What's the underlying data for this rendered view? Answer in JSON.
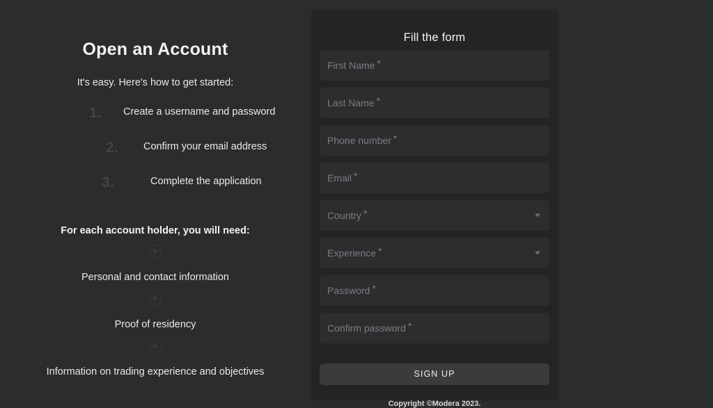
{
  "page": {
    "background_color": "#2b2c2e"
  },
  "left": {
    "title": "Open an Account",
    "intro": "It's easy. Here's how to get started:",
    "steps": [
      {
        "number": "1.",
        "text": "Create a username and password"
      },
      {
        "number": "2.",
        "text": "Confirm your email address"
      },
      {
        "number": "3.",
        "text": "Complete the application"
      }
    ],
    "needs_heading": "For each account holder, you will need:",
    "needs": [
      {
        "icon": "plus-circle-icon",
        "text": "Personal and contact information"
      },
      {
        "icon": "plus-circle-icon",
        "text": "Proof of residency"
      },
      {
        "icon": "plus-circle-icon",
        "text": "Information on trading experience and objectives"
      }
    ]
  },
  "form": {
    "title": "Fill the form",
    "background_color": "#232426",
    "field_background_color": "#2c2d2f",
    "required_marker": "*",
    "fields": [
      {
        "label": "First Name",
        "value": "",
        "placeholder": "First Name",
        "type": "text",
        "required": true
      },
      {
        "label": "Last Name",
        "value": "",
        "placeholder": "Last Name",
        "type": "text",
        "required": true
      },
      {
        "label": "Phone number",
        "value": "",
        "placeholder": "Phone number",
        "type": "tel",
        "required": true
      },
      {
        "label": "Email",
        "value": "",
        "placeholder": "Email",
        "type": "email",
        "required": true
      },
      {
        "label": "Country",
        "value": "",
        "placeholder": "Country",
        "type": "select",
        "required": true
      },
      {
        "label": "Experience",
        "value": "",
        "placeholder": "Experience",
        "type": "select",
        "required": true
      },
      {
        "label": "Password",
        "value": "",
        "placeholder": "Password",
        "type": "password",
        "required": true
      },
      {
        "label": "Confirm password",
        "value": "",
        "placeholder": "Confirm password",
        "type": "password",
        "required": true
      }
    ],
    "submit_label": "SIGN UP",
    "submit_color": "#3a3b3d",
    "copyright": "Copyright ©Modera 2023."
  }
}
